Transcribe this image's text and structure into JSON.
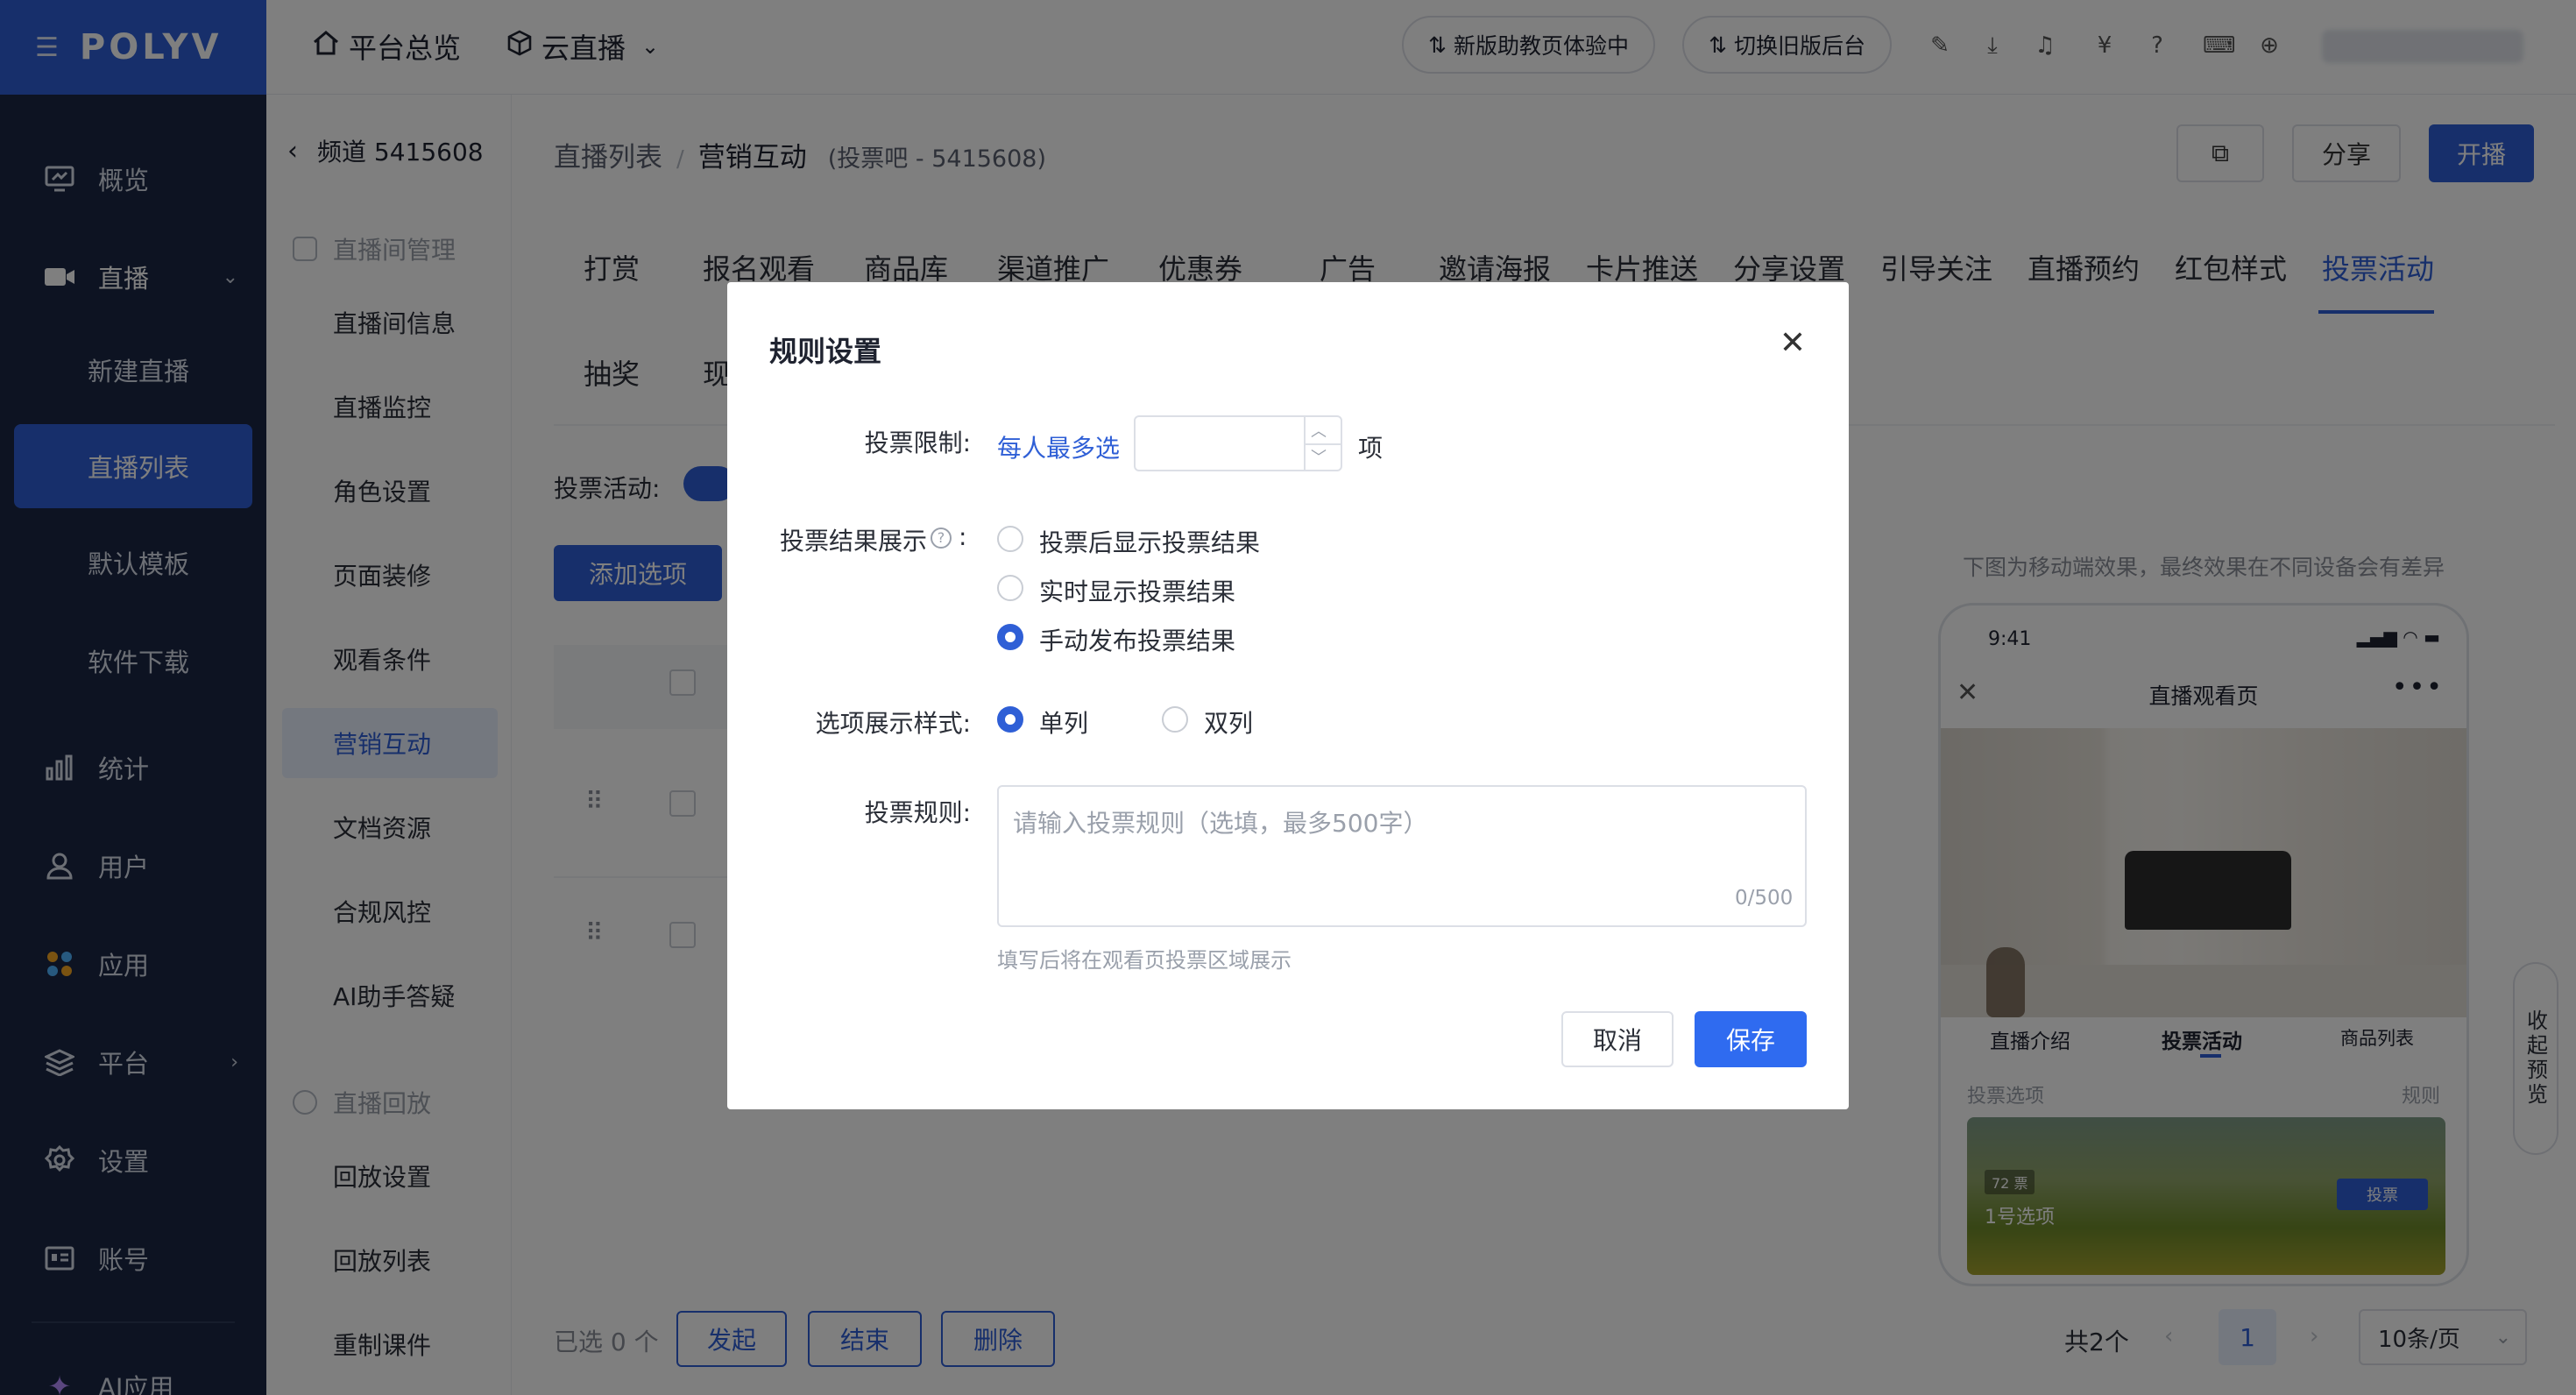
{
  "nav": {
    "logo": "POLYV",
    "items": [
      {
        "label": "概览"
      },
      {
        "label": "直播"
      },
      {
        "label": "统计"
      },
      {
        "label": "用户"
      },
      {
        "label": "应用"
      },
      {
        "label": "平台"
      },
      {
        "label": "设置"
      },
      {
        "label": "账号"
      },
      {
        "label": "AI应用"
      }
    ],
    "live_sub": [
      "新建直播",
      "直播列表",
      "默认模板",
      "软件下载"
    ]
  },
  "topbar": {
    "overview": "平台总览",
    "cloud_live": "云直播",
    "pill_assistant": "新版助教页体验中",
    "pill_switch": "切换旧版后台"
  },
  "side2": {
    "channel": "频道 5415608",
    "group_room": "直播间管理",
    "items": [
      "直播间信息",
      "直播监控",
      "角色设置",
      "页面装修",
      "观看条件",
      "营销互动",
      "文档资源",
      "合规风控",
      "AI助手答疑"
    ],
    "group_replay": "直播回放",
    "replay_items": [
      "回放设置",
      "回放列表",
      "重制课件"
    ]
  },
  "main": {
    "breadcrumb": {
      "parent": "直播列表",
      "current": "营销互动",
      "sub": "(投票吧 - 5415608)"
    },
    "share": "分享",
    "start": "开播",
    "tabs": [
      "打赏",
      "报名观看",
      "商品库",
      "渠道推广",
      "优惠券",
      "广告",
      "邀请海报",
      "卡片推送",
      "分享设置",
      "引导关注",
      "直播预约",
      "红包样式",
      "投票活动"
    ],
    "tabs_row2": [
      "抽奖",
      "现"
    ],
    "vote_activity_label": "投票活动:",
    "add_option": "添加选项",
    "bottom": {
      "selected": "已选 0 个",
      "launch": "发起",
      "end": "结束",
      "delete": "删除",
      "total": "共2个",
      "page": "1",
      "page_size": "10条/页"
    }
  },
  "preview": {
    "note": "下图为移动端效果，最终效果在不同设备会有差异",
    "time": "9:41",
    "title": "直播观看页",
    "tabs": [
      "直播介绍",
      "投票活动",
      "商品列表"
    ],
    "option_label": "投票选项",
    "rule": "规则",
    "votes": "72 票",
    "option_name": "1号选项",
    "vote_btn": "投票",
    "collapse": "收起预览"
  },
  "modal": {
    "title": "规则设置",
    "limit_label": "投票限制:",
    "limit_prefix": "每人最多选",
    "limit_value": "",
    "limit_suffix": "项",
    "result_label": "投票结果展示",
    "result_colon": ":",
    "result_options": [
      "投票后显示投票结果",
      "实时显示投票结果",
      "手动发布投票结果"
    ],
    "result_selected": 2,
    "style_label": "选项展示样式:",
    "style_options": [
      "单列",
      "双列"
    ],
    "style_selected": 0,
    "rules_label": "投票规则:",
    "rules_placeholder": "请输入投票规则（选填，最多500字）",
    "rules_count": "0/500",
    "hint": "填写后将在观看页投票区域展示",
    "cancel": "取消",
    "save": "保存"
  }
}
